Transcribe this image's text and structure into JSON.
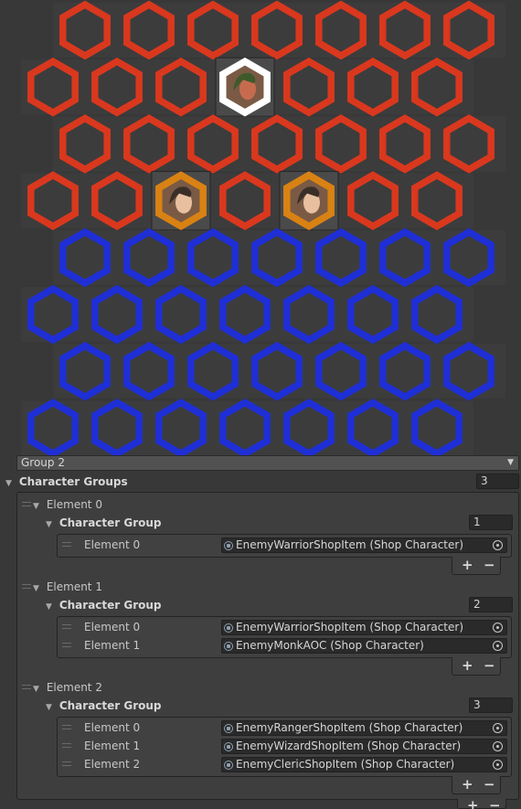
{
  "grid": {
    "row_count": 8,
    "rows": [
      {
        "color": "#d9381e",
        "count": 7,
        "offset": "right"
      },
      {
        "color": "#d9381e",
        "count": 7,
        "offset": "left"
      },
      {
        "color": "#d9381e",
        "count": 7,
        "offset": "right"
      },
      {
        "color": "#d9381e",
        "count": 7,
        "offset": "left"
      },
      {
        "color": "#1f2fd6",
        "count": 7,
        "offset": "right"
      },
      {
        "color": "#1f2fd6",
        "count": 7,
        "offset": "left"
      },
      {
        "color": "#1f2fd6",
        "count": 7,
        "offset": "right"
      },
      {
        "color": "#1f2fd6",
        "count": 7,
        "offset": "left"
      }
    ],
    "placed_characters": [
      {
        "row": 1,
        "col": 3,
        "frame": "white",
        "frame_color": "#ffffff",
        "portrait": "warrior-portrait-icon"
      },
      {
        "row": 3,
        "col": 2,
        "frame": "orange",
        "frame_color": "#d98214",
        "portrait": "hooded-character-portrait-icon"
      },
      {
        "row": 3,
        "col": 4,
        "frame": "orange",
        "frame_color": "#d98214",
        "portrait": "hooded-character-portrait-icon"
      }
    ]
  },
  "group_dropdown": {
    "value": "Group 2"
  },
  "character_groups": {
    "label": "Character Groups",
    "count": "3",
    "elements": [
      {
        "label": "Element 0",
        "group_label": "Character Group",
        "count": "1",
        "items": [
          {
            "label": "Element 0",
            "value": "EnemyWarriorShopItem (Shop Character)"
          }
        ]
      },
      {
        "label": "Element 1",
        "group_label": "Character Group",
        "count": "2",
        "items": [
          {
            "label": "Element 0",
            "value": "EnemyWarriorShopItem (Shop Character)"
          },
          {
            "label": "Element 1",
            "value": "EnemyMonkAOC (Shop Character)"
          }
        ]
      },
      {
        "label": "Element 2",
        "group_label": "Character Group",
        "count": "3",
        "items": [
          {
            "label": "Element 0",
            "value": "EnemyRangerShopItem (Shop Character)"
          },
          {
            "label": "Element 1",
            "value": "EnemyWizardShopItem (Shop Character)"
          },
          {
            "label": "Element 2",
            "value": "EnemyClericShopItem (Shop Character)"
          }
        ]
      }
    ]
  },
  "list_buttons": {
    "add": "+",
    "remove": "−"
  }
}
